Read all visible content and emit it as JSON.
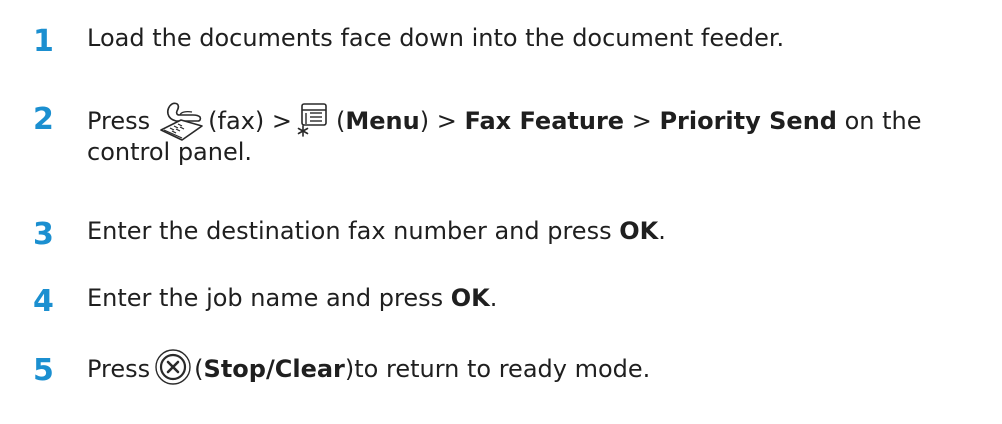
{
  "steps": [
    {
      "number": "1",
      "text": "Load the documents face down into the document feeder."
    },
    {
      "number": "2",
      "press": "Press",
      "fax_label": "(fax) >",
      "menu_open": "(",
      "menu_label": "Menu",
      "menu_close": ") >",
      "fax_feature": "Fax Feature",
      "sep": ">",
      "priority_send": "Priority Send",
      "on_the": "on the",
      "line2": "control panel.",
      "icons": [
        "fax-icon",
        "menu-icon"
      ]
    },
    {
      "number": "3",
      "text": "Enter the destination fax number and press",
      "ok": "OK",
      "end": "."
    },
    {
      "number": "4",
      "text": "Enter the job name and press",
      "ok": "OK",
      "end": "."
    },
    {
      "number": "5",
      "press": "Press",
      "stop_open": "(",
      "stop_label": "Stop/Clear",
      "stop_rest": ")to return to ready mode.",
      "icons": [
        "stop-clear-icon"
      ]
    }
  ],
  "colors": {
    "step_number": "#1b8fd0",
    "text": "#1f1f1f"
  }
}
